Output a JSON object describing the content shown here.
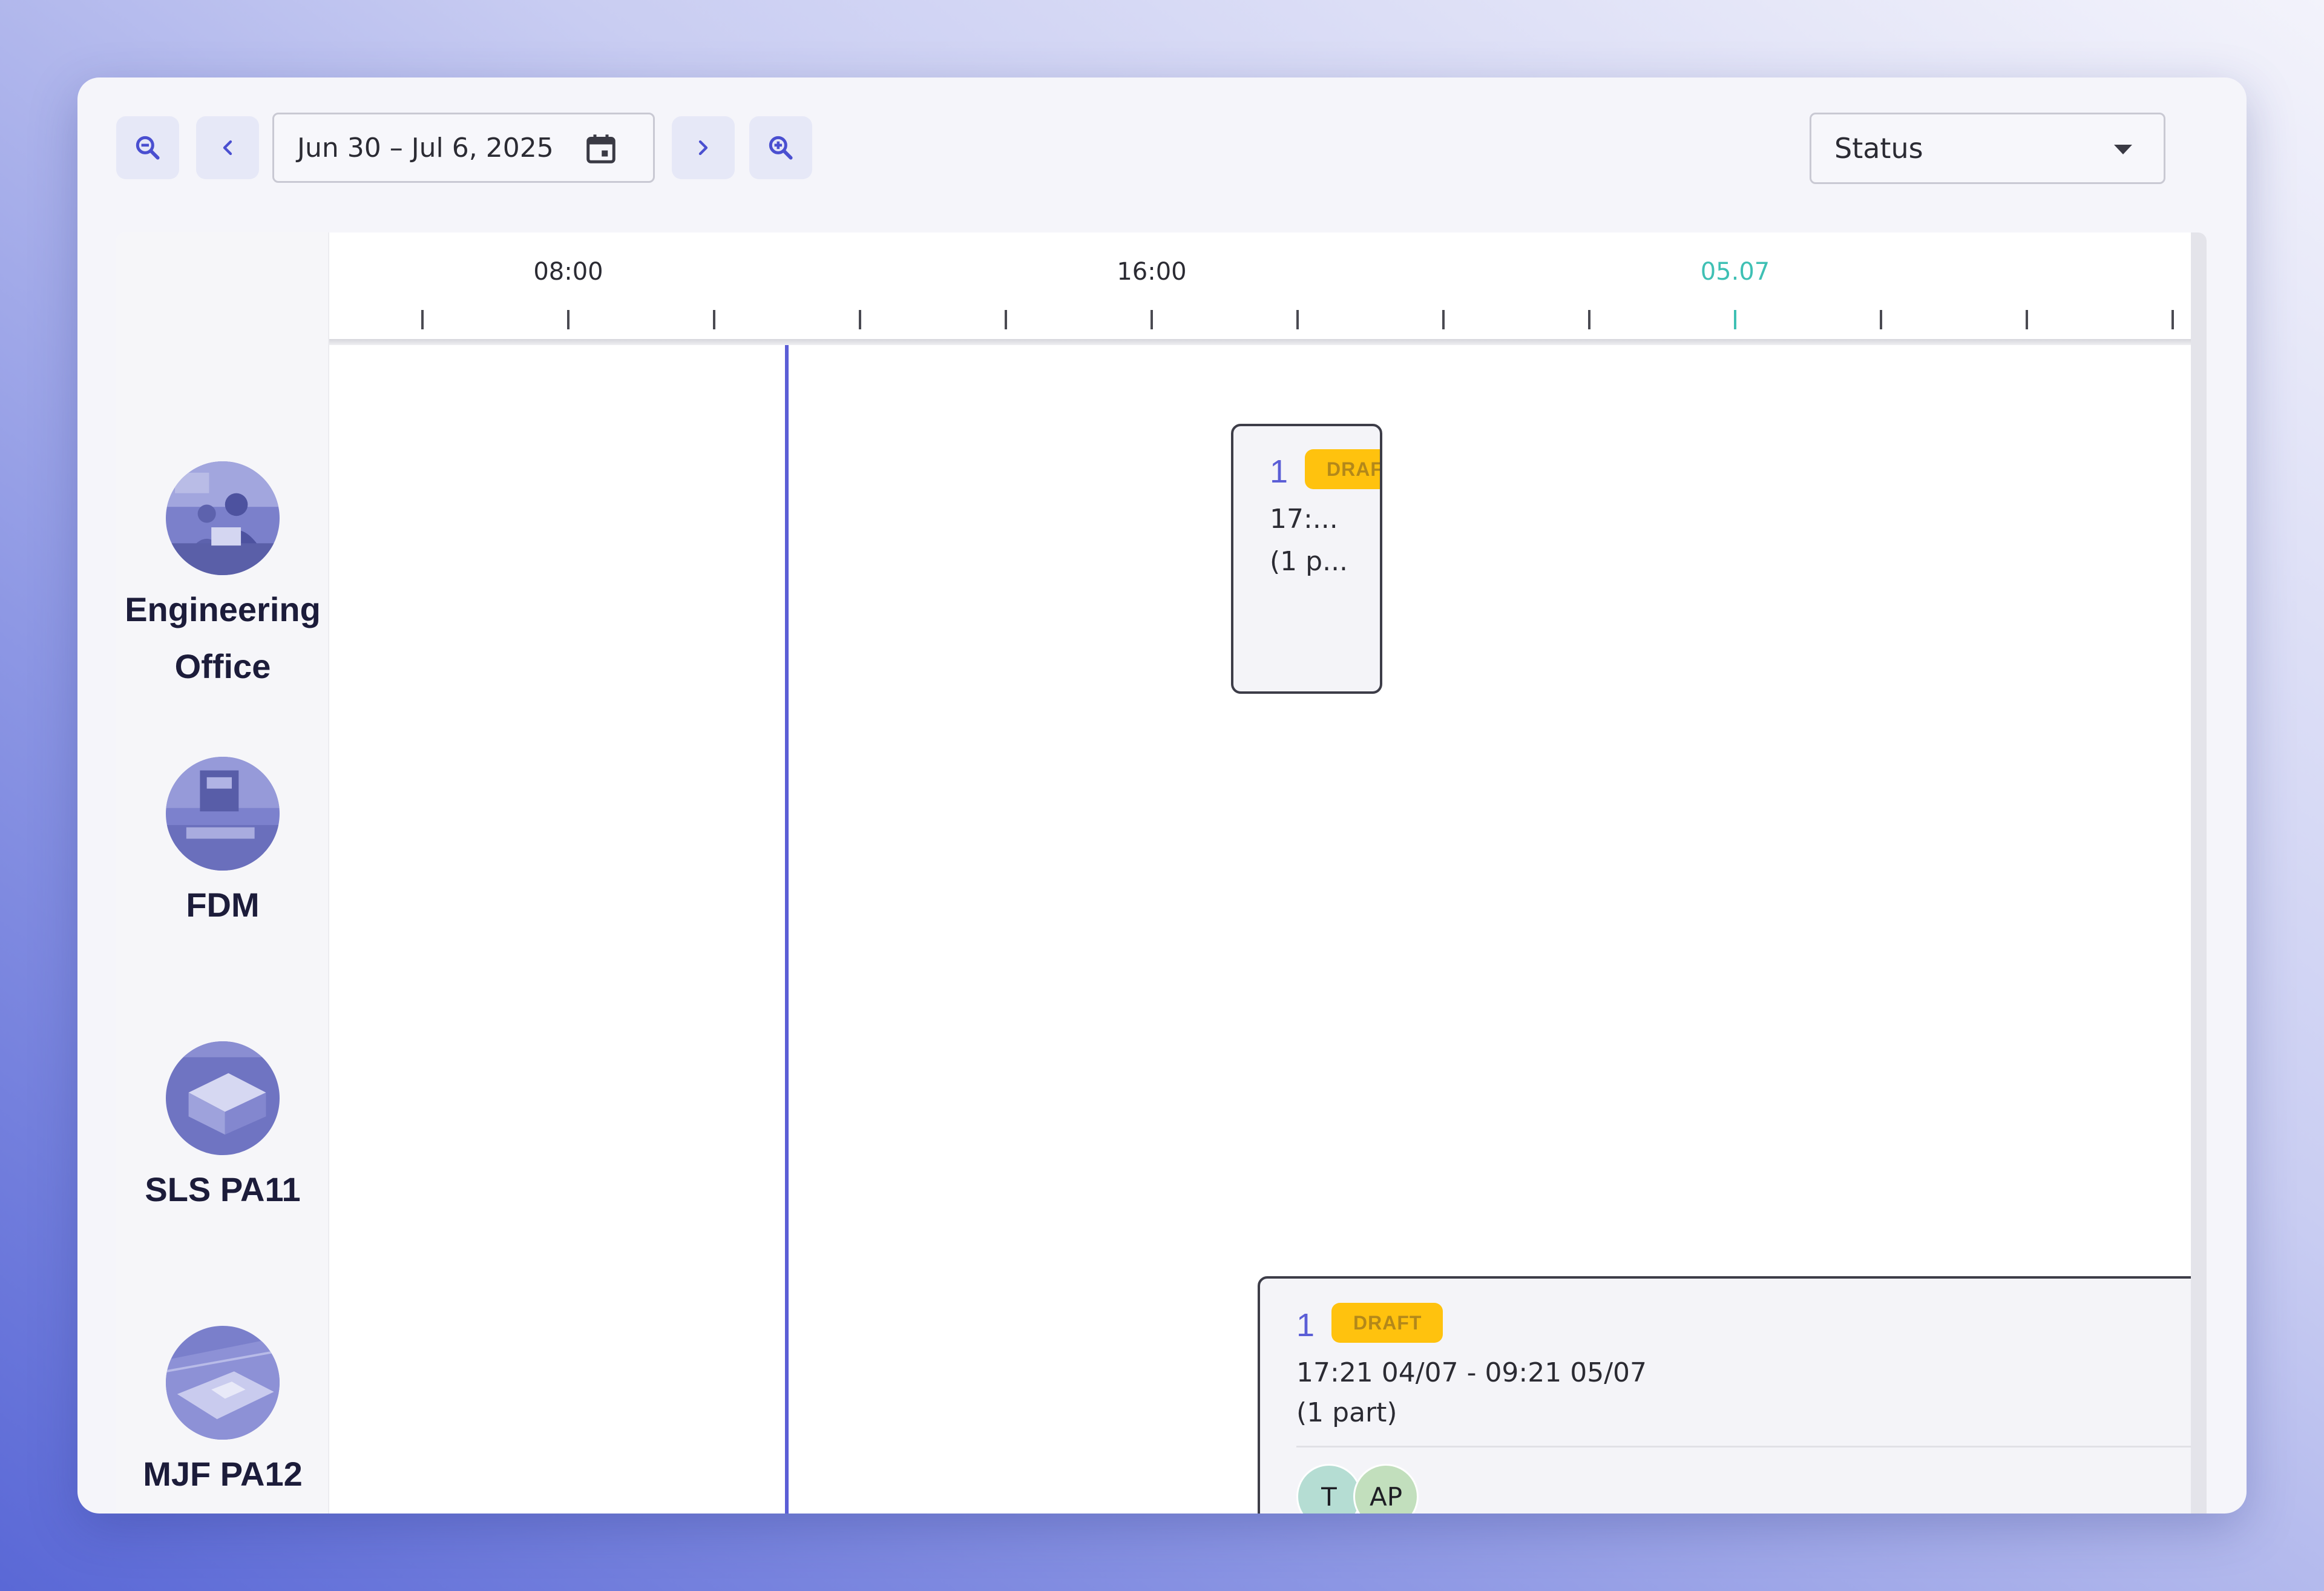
{
  "toolbar": {
    "date_range": "Jun 30 – Jul 6, 2025",
    "status_select": "Status"
  },
  "timeline": {
    "ticks": [
      {
        "label": ""
      },
      {
        "label": "08:00"
      },
      {
        "label": ""
      },
      {
        "label": ""
      },
      {
        "label": ""
      },
      {
        "label": "16:00"
      },
      {
        "label": ""
      },
      {
        "label": ""
      },
      {
        "label": ""
      },
      {
        "label": "05.07",
        "highlight": true
      },
      {
        "label": ""
      },
      {
        "label": ""
      },
      {
        "label": ""
      }
    ],
    "highlight_color": "#3fc0b4",
    "now_line_color": "#5b5ed6"
  },
  "resources": [
    {
      "name_lines": [
        "Engineering",
        "Office"
      ]
    },
    {
      "name_lines": [
        "FDM"
      ]
    },
    {
      "name_lines": [
        "SLS PA11"
      ]
    },
    {
      "name_lines": [
        "MJF PA12"
      ]
    }
  ],
  "events": [
    {
      "number": "1",
      "status": "DRAFT",
      "time_truncated": "17:...",
      "parts_truncated": "(1 p..."
    },
    {
      "number": "1",
      "status": "DRAFT",
      "time": "17:21 04/07 - 09:21 05/07",
      "parts": "(1 part)",
      "assignees": [
        {
          "initials": "T",
          "color": "#b5ddd3"
        },
        {
          "initials": "AP",
          "color": "#c2dfbd"
        }
      ]
    }
  ],
  "colors": {
    "accent": "#5b5ed6",
    "badge": "#ffc20e",
    "badge_text": "#b3881a"
  }
}
